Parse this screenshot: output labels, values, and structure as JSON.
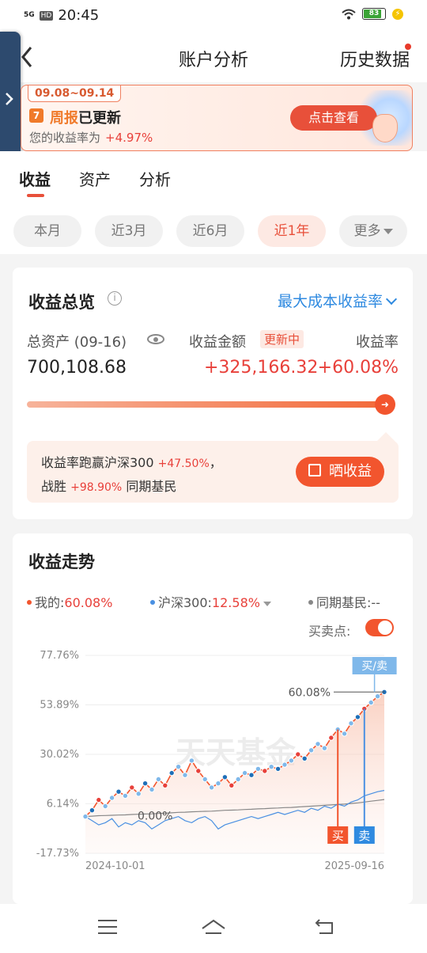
{
  "status_bar": {
    "network": "5G",
    "hd": "HD",
    "time": "20:45",
    "battery": "83"
  },
  "header": {
    "title": "账户分析",
    "history": "历史数据"
  },
  "banner": {
    "date_range": "09.08~09.14",
    "calendar_day": "7",
    "headline_accent": "周报",
    "headline_rest": "已更新",
    "subtext": "您的收益率为",
    "rate": "+4.97%",
    "button": "点击查看"
  },
  "tabs": [
    {
      "label": "收益"
    },
    {
      "label": "资产"
    },
    {
      "label": "分析"
    }
  ],
  "periods": [
    {
      "label": "本月"
    },
    {
      "label": "近3月"
    },
    {
      "label": "近6月"
    },
    {
      "label": "近1年"
    },
    {
      "label": "更多"
    }
  ],
  "overview": {
    "title": "收益总览",
    "mode": "最大成本收益率",
    "total_assets_label": "总资产 (09-16)",
    "total_assets": "700,108.68",
    "profit_label": "收益金额",
    "updating_badge": "更新中",
    "profit": "+325,166.32",
    "rate_label": "收益率",
    "rate": "+60.08%",
    "compare_prefix": "收益率跑赢沪深300",
    "compare_hs300": "+47.50%",
    "compare_suffix": "，",
    "beat_prefix": "战胜",
    "beat_value": "+98.90%",
    "beat_suffix": "同期基民",
    "share_button": "晒收益"
  },
  "trend": {
    "title": "收益走势",
    "legend_mine_label": "我的:",
    "legend_mine_value": "60.08%",
    "legend_hs300_label": "沪深300:",
    "legend_hs300_value": "12.58%",
    "legend_peers_label": "同期基民:",
    "legend_peers_value": "--",
    "buy_sell_points": "买卖点:",
    "colors": {
      "mine": "#f2552e",
      "hs300": "#4a90e2",
      "peers": "#888888"
    }
  },
  "chart_data": {
    "type": "line",
    "y_ticks": [
      "77.76%",
      "53.89%",
      "30.02%",
      "6.14%",
      "-17.73%"
    ],
    "ylim": [
      -17.73,
      77.76
    ],
    "x_ticks": [
      "2024-10-01",
      "2025-09-16"
    ],
    "watermark": "天天基金",
    "series": [
      {
        "name": "我的",
        "values": [
          0,
          3,
          8,
          5,
          9,
          12,
          10,
          14,
          11,
          16,
          13,
          18,
          15,
          21,
          24,
          20,
          27,
          22,
          18,
          14,
          16,
          19,
          15,
          18,
          21,
          20,
          23,
          22,
          24,
          23,
          25,
          27,
          30,
          28,
          32,
          35,
          33,
          38,
          42,
          40,
          45,
          48,
          52,
          55,
          58,
          60.08
        ]
      },
      {
        "name": "沪深300",
        "values": [
          0,
          -2,
          -4,
          -3,
          -1,
          -5,
          -3,
          -4,
          -2,
          -3,
          -6,
          -4,
          -2,
          -1,
          0,
          -2,
          -3,
          -1,
          0,
          -2,
          -6,
          -4,
          -3,
          -2,
          -1,
          0,
          -1,
          0,
          1,
          2,
          1,
          2,
          3,
          2,
          4,
          3,
          5,
          4,
          6,
          5,
          7,
          8,
          10,
          11,
          12,
          12.58
        ]
      },
      {
        "name": "同期基民",
        "values": [
          0,
          0.2,
          0.4,
          0.5,
          0.6,
          0.7,
          0.8,
          1,
          1.1,
          1.2,
          1.3,
          1.5,
          1.6,
          1.8,
          2,
          2.1,
          2.3,
          2.4,
          2.5,
          2.6,
          2.8,
          3,
          3.1,
          3.2,
          3.4,
          3.5,
          3.7,
          3.8,
          4,
          4.1,
          4.3,
          4.4,
          4.6,
          4.8,
          5,
          5.2,
          5.4,
          5.6,
          5.8,
          6,
          6.3,
          6.6,
          7,
          7.4,
          7.8,
          8.2
        ]
      }
    ],
    "annotations": {
      "final_label": "60.08%",
      "start_label": "0.00%",
      "buy_sell_label": "买/卖",
      "buy_label": "买",
      "sell_label": "卖"
    }
  }
}
